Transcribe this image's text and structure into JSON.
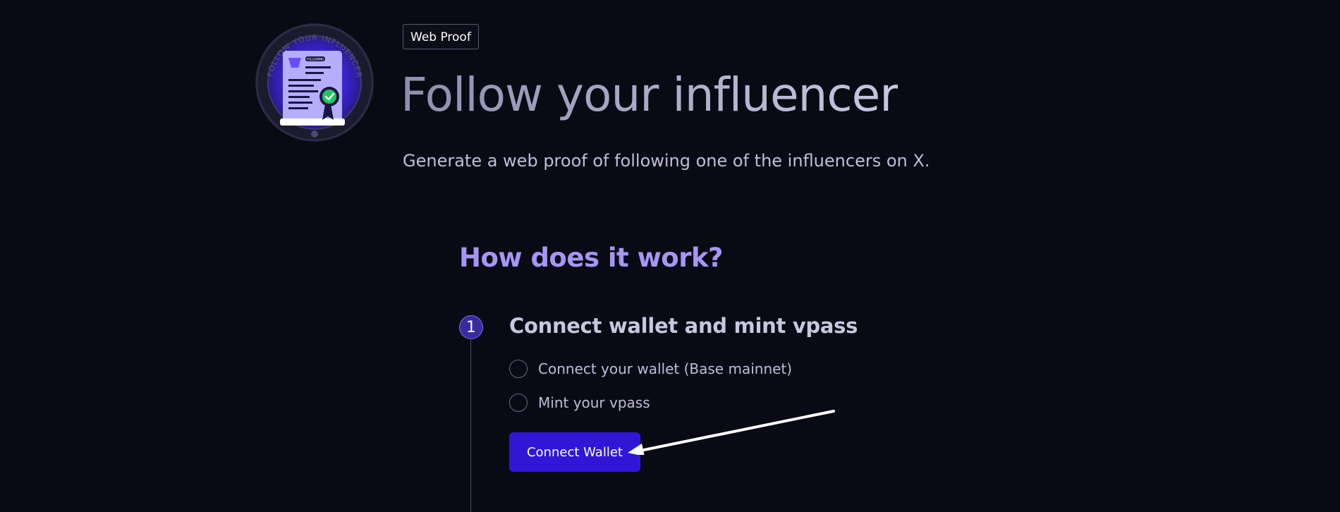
{
  "badge": {
    "ring_text": "FOLLOW YOUR INFLUENCER",
    "pill_text": "FOLLOWING"
  },
  "header": {
    "tag": "Web Proof",
    "title": "Follow your influencer",
    "subtitle": "Generate a web proof of following one of the influencers on X."
  },
  "how": {
    "title": "How does it work?",
    "steps": [
      {
        "number": "1",
        "title": "Connect wallet and mint vpass",
        "checklist": [
          "Connect your wallet (Base mainnet)",
          "Mint your vpass"
        ],
        "button_label": "Connect Wallet"
      }
    ]
  },
  "colors": {
    "background": "#0a0a14",
    "accent": "#3216d6",
    "heading_purple": "#a596f4",
    "badge_green": "#22c55e"
  }
}
